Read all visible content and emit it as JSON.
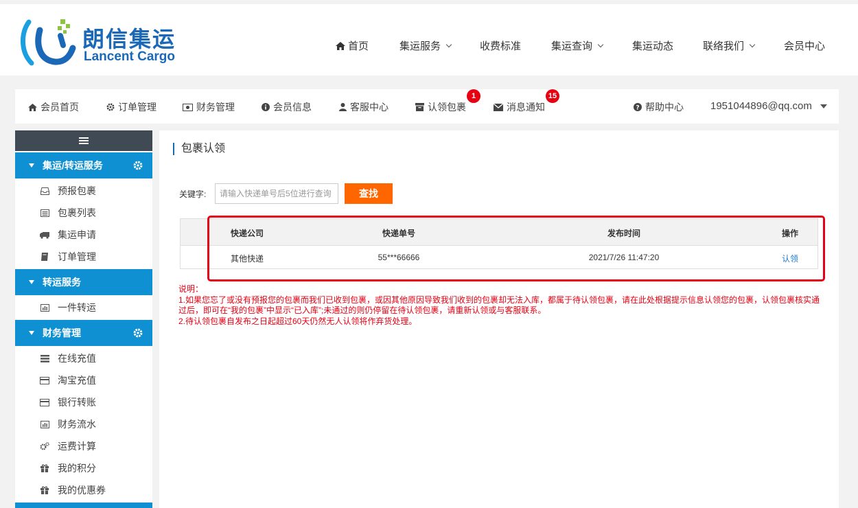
{
  "brand": {
    "name_cn": "朗信集运",
    "name_en": "Lancent Cargo"
  },
  "main_nav": [
    {
      "label": "首页",
      "icon": "home-icon"
    },
    {
      "label": "集运服务",
      "dropdown": true
    },
    {
      "label": "收费标准"
    },
    {
      "label": "集运查询",
      "dropdown": true
    },
    {
      "label": "集运动态"
    },
    {
      "label": "联络我们",
      "dropdown": true
    },
    {
      "label": "会员中心"
    }
  ],
  "member_nav": [
    {
      "label": "会员首页",
      "icon": "home-icon"
    },
    {
      "label": "订单管理",
      "icon": "gear-icon"
    },
    {
      "label": "财务管理",
      "icon": "money-icon"
    },
    {
      "label": "会员信息",
      "icon": "info-icon"
    },
    {
      "label": "客服中心",
      "icon": "user-icon"
    },
    {
      "label": "认领包裹",
      "icon": "archive-icon",
      "badge": "1"
    },
    {
      "label": "消息通知",
      "icon": "envelope-icon",
      "badge": "15"
    },
    {
      "label": "帮助中心",
      "icon": "question-icon"
    }
  ],
  "user_email": "1951044896@qq.com",
  "sidebar": {
    "groups": [
      {
        "label": "集运/转运服务",
        "items": [
          "预报包裹",
          "包裹列表",
          "集运申请",
          "订单管理"
        ]
      },
      {
        "label": "转运服务",
        "items": [
          "一件转运"
        ]
      },
      {
        "label": "财务管理",
        "items": [
          "在线充值",
          "淘宝充值",
          "银行转账",
          "财务流水",
          "运费计算",
          "我的积分",
          "我的优惠券"
        ]
      }
    ]
  },
  "page_title": "包裹认领",
  "search": {
    "label": "关键字:",
    "placeholder": "请输入快递单号后5位进行查询",
    "button": "查找"
  },
  "table": {
    "headers": [
      "快递公司",
      "快递单号",
      "发布时间",
      "操作"
    ],
    "rows": [
      {
        "company": "其他快递",
        "tracking": "55***66666",
        "time": "2021/7/26 11:47:20",
        "action": "认领"
      }
    ]
  },
  "notes": {
    "title": "说明：",
    "line1": "1.如果您忘了或没有预报您的包裹而我们已收到包裹，或因其他原因导致我们收到的包裹却无法入库，都属于待认领包裹，请在此处根据提示信息认领您的包裹，认领包裹核实通过后，即可在“我的包裹”中显示“已入库”;未通过的则仍停留在待认领包裹，请重新认领或与客服联系。",
    "line2": "2.待认领包裹自发布之日起超过60天仍然无人认领将作弃货处理。"
  },
  "colors": {
    "brand_blue": "#1b69b6",
    "sidebar_blue": "#0e90d2",
    "sidebar_dark": "#3f4a55",
    "search_orange": "#ff6600",
    "alert_red": "#e60012",
    "link_blue": "#1b7bd1"
  }
}
